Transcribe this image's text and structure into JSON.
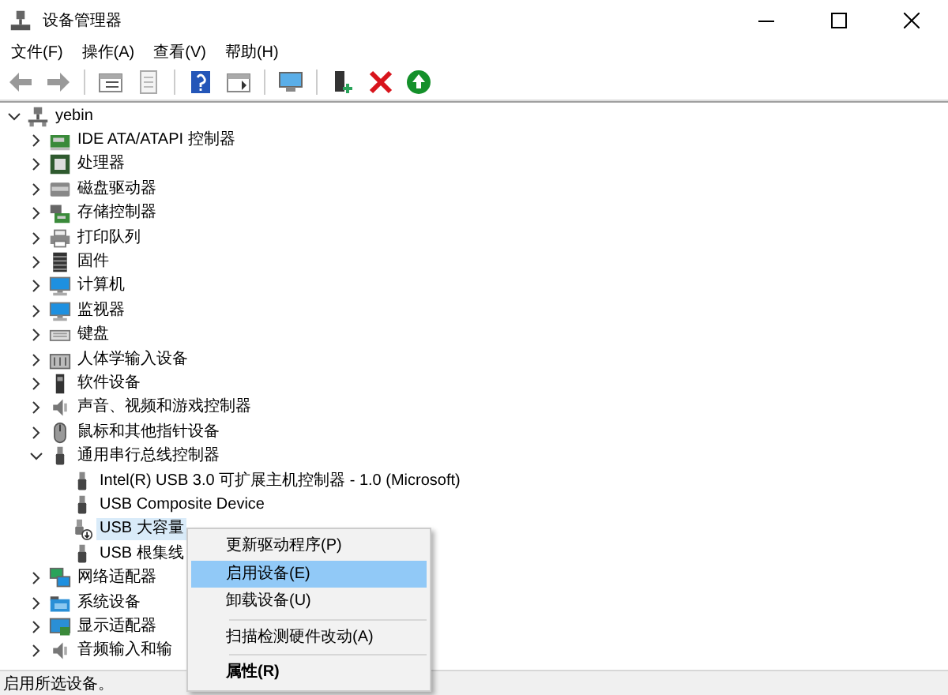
{
  "window": {
    "title": "设备管理器"
  },
  "menu_bar": [
    {
      "label": "文件(F)"
    },
    {
      "label": "操作(A)"
    },
    {
      "label": "查看(V)"
    },
    {
      "label": "帮助(H)"
    }
  ],
  "toolbar": [
    {
      "kind": "back"
    },
    {
      "kind": "forward"
    },
    {
      "kind": "separator"
    },
    {
      "kind": "grid"
    },
    {
      "kind": "page"
    },
    {
      "kind": "separator"
    },
    {
      "kind": "help"
    },
    {
      "kind": "panel"
    },
    {
      "kind": "separator"
    },
    {
      "kind": "monitor"
    },
    {
      "kind": "separator"
    },
    {
      "kind": "device"
    },
    {
      "kind": "remove"
    },
    {
      "kind": "enable"
    }
  ],
  "tree": [
    {
      "label": "yebin",
      "kind": "computer",
      "expanded": true,
      "selected": false,
      "children": [
        {
          "label": "IDE ATA/ATAPI 控制器",
          "kind": "ide",
          "expanded": false,
          "selected": false
        },
        {
          "label": "处理器",
          "kind": "cpu",
          "expanded": false,
          "selected": false
        },
        {
          "label": "磁盘驱动器",
          "kind": "disk",
          "expanded": false,
          "selected": false
        },
        {
          "label": "存储控制器",
          "kind": "storage",
          "expanded": false,
          "selected": false
        },
        {
          "label": "打印队列",
          "kind": "printer",
          "expanded": false,
          "selected": false
        },
        {
          "label": "固件",
          "kind": "firmware",
          "expanded": false,
          "selected": false
        },
        {
          "label": "计算机",
          "kind": "monitor",
          "expanded": false,
          "selected": false
        },
        {
          "label": "监视器",
          "kind": "monitor",
          "expanded": false,
          "selected": false
        },
        {
          "label": "键盘",
          "kind": "keyboard",
          "expanded": false,
          "selected": false
        },
        {
          "label": "人体学输入设备",
          "kind": "hid",
          "expanded": false,
          "selected": false
        },
        {
          "label": "软件设备",
          "kind": "software",
          "expanded": false,
          "selected": false
        },
        {
          "label": "声音、视频和游戏控制器",
          "kind": "sound",
          "expanded": false,
          "selected": false
        },
        {
          "label": "鼠标和其他指针设备",
          "kind": "mouse",
          "expanded": false,
          "selected": false
        },
        {
          "label": "通用串行总线控制器",
          "kind": "usb",
          "expanded": true,
          "selected": false,
          "children": [
            {
              "label": "Intel(R) USB 3.0 可扩展主机控制器 - 1.0 (Microsoft)",
              "kind": "usb",
              "selected": false
            },
            {
              "label": "USB Composite Device",
              "kind": "usb",
              "selected": false
            },
            {
              "label": "USB 大容量",
              "kind": "usb_disabled",
              "selected": true
            },
            {
              "label": "USB 根集线",
              "kind": "usb",
              "selected": false
            }
          ]
        },
        {
          "label": "网络适配器",
          "kind": "network",
          "expanded": false,
          "selected": false
        },
        {
          "label": "系统设备",
          "kind": "system",
          "expanded": false,
          "selected": false
        },
        {
          "label": "显示适配器",
          "kind": "display",
          "expanded": false,
          "selected": false
        },
        {
          "label": "音频输入和输",
          "kind": "sound",
          "expanded": false,
          "selected": false
        }
      ]
    }
  ],
  "context_menu": [
    {
      "kind": "item",
      "label": "更新驱动程序(P)",
      "selected": false,
      "default": false
    },
    {
      "kind": "item",
      "label": "启用设备(E)",
      "selected": true,
      "default": false
    },
    {
      "kind": "item",
      "label": "卸载设备(U)",
      "selected": false,
      "default": false
    },
    {
      "kind": "separator"
    },
    {
      "kind": "item",
      "label": "扫描检测硬件改动(A)",
      "selected": false,
      "default": false
    },
    {
      "kind": "separator"
    },
    {
      "kind": "item",
      "label": "属性(R)",
      "selected": false,
      "default": true
    }
  ],
  "status_bar": {
    "text": "启用所选设备。"
  }
}
